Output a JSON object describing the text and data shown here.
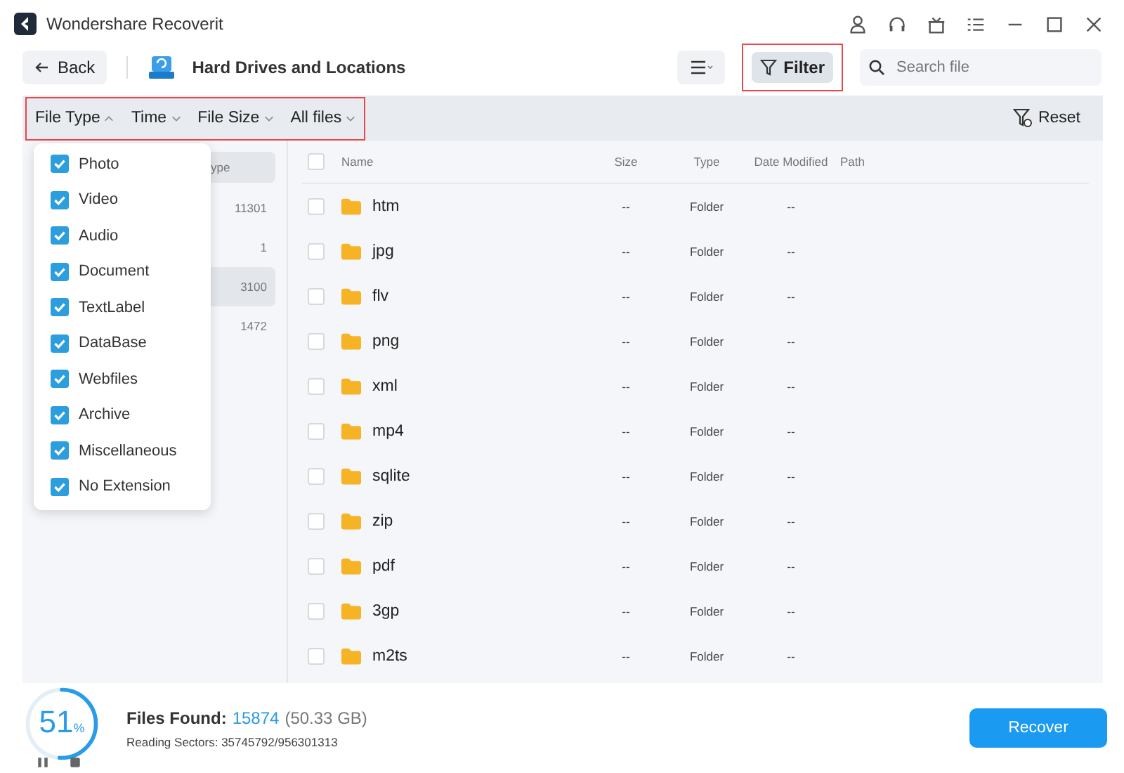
{
  "window": {
    "title": "Wondershare Recoverit"
  },
  "toolbar": {
    "back": "Back",
    "location": "Hard Drives and Locations",
    "filter": "Filter",
    "search": {
      "placeholder": "Search file"
    }
  },
  "filter_bar": {
    "filters": [
      {
        "label": "File Type",
        "expanded": true
      },
      {
        "label": "Time",
        "expanded": false
      },
      {
        "label": "File Size",
        "expanded": false
      },
      {
        "label": "All files",
        "expanded": false
      }
    ],
    "reset": "Reset"
  },
  "file_type_menu": [
    {
      "label": "Photo",
      "checked": true
    },
    {
      "label": "Video",
      "checked": true
    },
    {
      "label": "Audio",
      "checked": true
    },
    {
      "label": "Document",
      "checked": true
    },
    {
      "label": "TextLabel",
      "checked": true
    },
    {
      "label": "DataBase",
      "checked": true
    },
    {
      "label": "Webfiles",
      "checked": true
    },
    {
      "label": "Archive",
      "checked": true
    },
    {
      "label": "Miscellaneous",
      "checked": true
    },
    {
      "label": "No Extension",
      "checked": true
    }
  ],
  "sidebar": {
    "header": "ype",
    "items": [
      {
        "count": "11301",
        "selected": false
      },
      {
        "count": "1",
        "selected": false
      },
      {
        "count": "3100",
        "selected": true
      },
      {
        "count": "1472",
        "selected": false
      }
    ]
  },
  "table": {
    "select_all_checked": false,
    "columns": [
      "Name",
      "Size",
      "Type",
      "Date Modified",
      "Path"
    ],
    "rows": [
      {
        "name": "htm",
        "checked": false,
        "size": "--",
        "type": "Folder",
        "modified": "--"
      },
      {
        "name": "jpg",
        "checked": false,
        "size": "--",
        "type": "Folder",
        "modified": "--"
      },
      {
        "name": "flv",
        "checked": false,
        "size": "--",
        "type": "Folder",
        "modified": "--"
      },
      {
        "name": "png",
        "checked": false,
        "size": "--",
        "type": "Folder",
        "modified": "--"
      },
      {
        "name": "xml",
        "checked": false,
        "size": "--",
        "type": "Folder",
        "modified": "--"
      },
      {
        "name": "mp4",
        "checked": false,
        "size": "--",
        "type": "Folder",
        "modified": "--"
      },
      {
        "name": "sqlite",
        "checked": false,
        "size": "--",
        "type": "Folder",
        "modified": "--"
      },
      {
        "name": "zip",
        "checked": false,
        "size": "--",
        "type": "Folder",
        "modified": "--"
      },
      {
        "name": "pdf",
        "checked": false,
        "size": "--",
        "type": "Folder",
        "modified": "--"
      },
      {
        "name": "3gp",
        "checked": false,
        "size": "--",
        "type": "Folder",
        "modified": "--"
      },
      {
        "name": "m2ts",
        "checked": false,
        "size": "--",
        "type": "Folder",
        "modified": "--"
      }
    ]
  },
  "status": {
    "progress": {
      "level": 0.51,
      "value": "51",
      "unit": "%"
    },
    "files_found_label": "Files Found:",
    "files_found_count": "15874",
    "files_found_size": "(50.33 GB)",
    "reading": "Reading Sectors: 35745792/956301313",
    "recover": "Recover"
  }
}
